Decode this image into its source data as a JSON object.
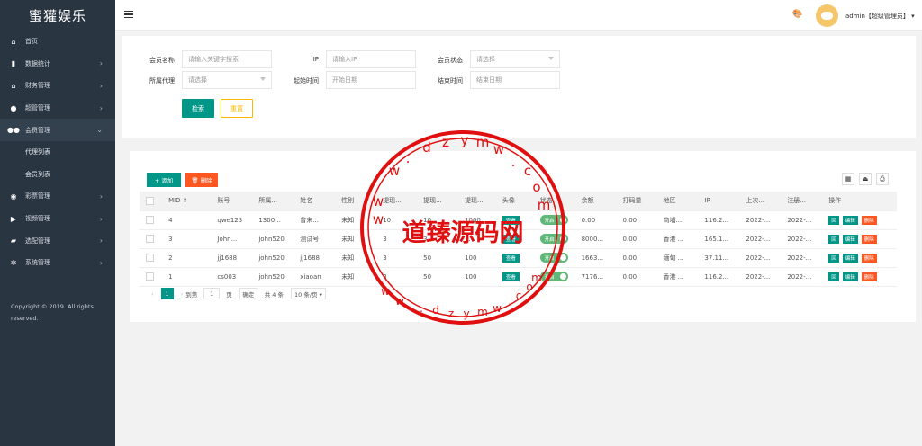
{
  "brand": "蜜獾娱乐",
  "sidebar": {
    "items": [
      {
        "label": "首页",
        "icon": "home-icon",
        "chevron": ""
      },
      {
        "label": "数据统计",
        "icon": "bar-chart-icon",
        "chevron": "›"
      },
      {
        "label": "财务管理",
        "icon": "bank-icon",
        "chevron": "›"
      },
      {
        "label": "超管管理",
        "icon": "user-icon",
        "chevron": "›"
      },
      {
        "label": "会员管理",
        "icon": "users-icon",
        "chevron": "⌄"
      }
    ],
    "sub_items": [
      {
        "label": "代理列表"
      },
      {
        "label": "会员列表"
      }
    ],
    "items2": [
      {
        "label": "彩票管理",
        "icon": "gamepad-icon",
        "chevron": "›"
      },
      {
        "label": "视频管理",
        "icon": "video-icon",
        "chevron": "›"
      },
      {
        "label": "选配管理",
        "icon": "tag-icon",
        "chevron": "›"
      },
      {
        "label": "系统管理",
        "icon": "gear-icon",
        "chevron": "›"
      }
    ],
    "copyright": "Copyright © 2019. All rights reserved."
  },
  "header": {
    "user": "admin【超级管理员】 ▾"
  },
  "filters": {
    "member_name_label": "会员名称",
    "member_name_placeholder": "请输入关键字搜索",
    "ip_label": "IP",
    "ip_placeholder": "请输入IP",
    "status_label": "会员状态",
    "status_value": "请选择",
    "agent_label": "所属代理",
    "agent_value": "请选择",
    "start_label": "起始时间",
    "start_placeholder": "开始日期",
    "end_label": "结束时间",
    "end_placeholder": "结束日期",
    "search_button": "检索",
    "reset_button": "重置"
  },
  "toolbar": {
    "add_label": "+ 添加",
    "delete_label": "🗑 删除"
  },
  "table": {
    "headers": [
      "",
      "MID ⇕",
      "账号",
      "所属...",
      "姓名",
      "性别",
      "提现...",
      "提现...",
      "提现...",
      "头像",
      "状态",
      "余额",
      "打码量",
      "地区",
      "IP",
      "上次...",
      "注册...",
      "操作"
    ],
    "rows": [
      {
        "mid": "4",
        "account": "qwe123",
        "agent": "1300...",
        "name": "曾末...",
        "sex": "未知",
        "w1": "10",
        "w2": "10",
        "w3": "1000...",
        "avatar": "查看",
        "status": "开启",
        "balance": "0.00",
        "bet": "0.00",
        "region": "商埔...",
        "ip": "116.2...",
        "last": "2022-...",
        "reg": "2022-..."
      },
      {
        "mid": "3",
        "account": "John...",
        "agent": "john520",
        "name": "测试号",
        "sex": "未知",
        "w1": "3",
        "w2": "3",
        "w3": "...",
        "avatar": "查看",
        "status": "开启",
        "balance": "8000...",
        "bet": "0.00",
        "region": "香港 ...",
        "ip": "165.1...",
        "last": "2022-...",
        "reg": "2022-..."
      },
      {
        "mid": "2",
        "account": "jj1688",
        "agent": "john520",
        "name": "jj1688",
        "sex": "未知",
        "w1": "3",
        "w2": "50",
        "w3": "100",
        "avatar": "查看",
        "status": "开启",
        "balance": "1663...",
        "bet": "0.00",
        "region": "缅甸 ...",
        "ip": "37.11...",
        "last": "2022-...",
        "reg": "2022-..."
      },
      {
        "mid": "1",
        "account": "cs003",
        "agent": "john520",
        "name": "xiaoan",
        "sex": "未知",
        "w1": "3",
        "w2": "50",
        "w3": "100",
        "avatar": "查看",
        "status": "开启",
        "balance": "7176...",
        "bet": "0.00",
        "region": "香港 ...",
        "ip": "116.2...",
        "last": "2022-...",
        "reg": "2022-..."
      }
    ],
    "ops": [
      "回",
      "编辑",
      "删除"
    ]
  },
  "pager": {
    "prev": "‹",
    "current": "1",
    "next": "›",
    "goto": "到第",
    "page_input": "1",
    "page_unit": "页",
    "confirm": "确定",
    "total": "共 4 条",
    "per_page": "10 条/页 ▾"
  },
  "watermark": {
    "center_text": "道臻源码网",
    "ring_text": "w w w . d z y m w . c o m"
  }
}
